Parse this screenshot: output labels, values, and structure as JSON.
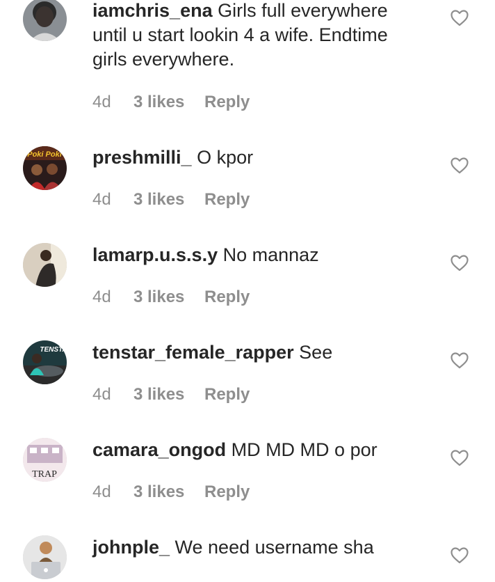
{
  "comments": [
    {
      "username": "iamchris_ena",
      "text": "Girls full everywhere until u start lookin 4 a wife. Endtime girls everywhere.",
      "time": "4d",
      "likes": "3 likes",
      "reply": "Reply",
      "avatar_icon": "profile-photo"
    },
    {
      "username": "preshmilli_",
      "text": "O kpor",
      "time": "4d",
      "likes": "3 likes",
      "reply": "Reply",
      "avatar_icon": "profile-photo",
      "avatar_text": "Poki Poki"
    },
    {
      "username": "lamarp.u.s.s.y",
      "text": "No mannaz",
      "time": "4d",
      "likes": "3 likes",
      "reply": "Reply",
      "avatar_icon": "profile-photo"
    },
    {
      "username": "tenstar_female_rapper",
      "text": "See",
      "time": "4d",
      "likes": "3 likes",
      "reply": "Reply",
      "avatar_icon": "profile-photo",
      "avatar_text": "TENSTA"
    },
    {
      "username": "camara_ongod",
      "text": "MD MD MD o por",
      "time": "4d",
      "likes": "3 likes",
      "reply": "Reply",
      "avatar_icon": "profile-photo",
      "avatar_text": "TRAP"
    },
    {
      "username": "johnple_",
      "text": "We need username sha",
      "avatar_icon": "profile-photo"
    }
  ],
  "icons": {
    "like": "heart-outline-icon"
  },
  "colors": {
    "text": "#262626",
    "meta": "#8e8e8e",
    "heart_stroke": "#8e8e8e",
    "background": "#ffffff"
  }
}
